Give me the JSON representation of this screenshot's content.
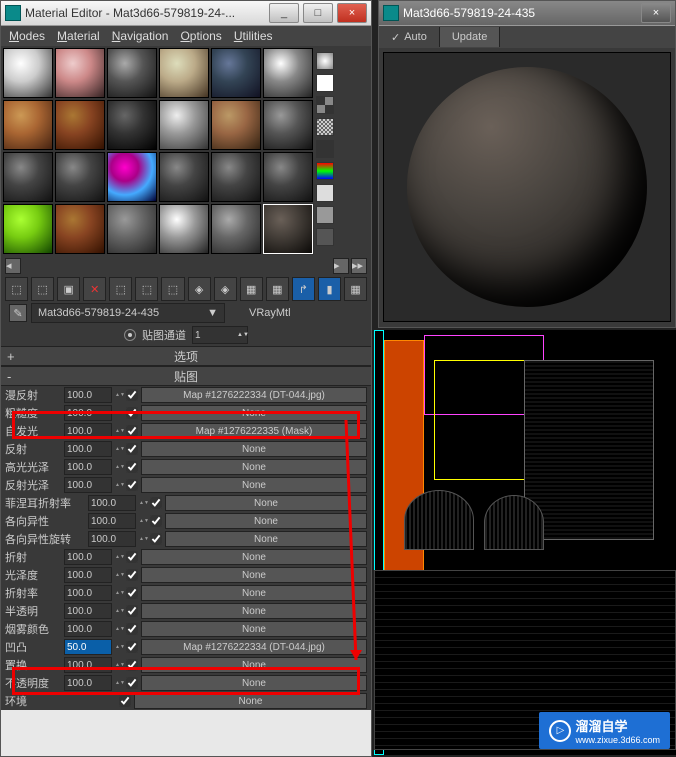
{
  "window": {
    "title": "Material Editor - Mat3d66-579819-24-...",
    "btn_min": "_",
    "btn_max": "□",
    "btn_close": "×"
  },
  "menu": {
    "modes": "Modes",
    "material": "Material",
    "navigation": "Navigation",
    "options": "Options",
    "utilities": "Utilities"
  },
  "material_name": "Mat3d66-579819-24-435",
  "material_type": "VRayMtl",
  "dropdown_arrow": "▼",
  "channel_label": "贴图通道",
  "channel_value": "1",
  "section_options": "选项",
  "section_maps": "贴图",
  "plus": "+",
  "minus": "-",
  "props": [
    {
      "label": "漫反射",
      "val": "100.0",
      "chk": true,
      "map": "Map #1276222334 (DT-044.jpg)",
      "hl": true
    },
    {
      "label": "粗糙度",
      "val": "100.0",
      "chk": true,
      "map": "None"
    },
    {
      "label": "自发光",
      "val": "100.0",
      "chk": true,
      "map": "Map #1276222335 (Mask)"
    },
    {
      "label": "反射",
      "val": "100.0",
      "chk": true,
      "map": "None"
    },
    {
      "label": "高光光泽",
      "val": "100.0",
      "chk": true,
      "map": "None"
    },
    {
      "label": "反射光泽",
      "val": "100.0",
      "chk": true,
      "map": "None"
    },
    {
      "label": "菲涅耳折射率",
      "val": "100.0",
      "chk": true,
      "map": "None",
      "wide": true
    },
    {
      "label": "各向异性",
      "val": "100.0",
      "chk": true,
      "map": "None",
      "wide": true
    },
    {
      "label": "各向异性旋转",
      "val": "100.0",
      "chk": true,
      "map": "None",
      "wide": true
    },
    {
      "label": "折射",
      "val": "100.0",
      "chk": true,
      "map": "None"
    },
    {
      "label": "光泽度",
      "val": "100.0",
      "chk": true,
      "map": "None"
    },
    {
      "label": "折射率",
      "val": "100.0",
      "chk": true,
      "map": "None"
    },
    {
      "label": "半透明",
      "val": "100.0",
      "chk": true,
      "map": "None"
    },
    {
      "label": "烟雾颜色",
      "val": "100.0",
      "chk": true,
      "map": "None"
    },
    {
      "label": "凹凸",
      "val": "50.0",
      "chk": true,
      "map": "Map #1276222334 (DT-044.jpg)",
      "hl": true,
      "selected": true
    },
    {
      "label": "置换",
      "val": "100.0",
      "chk": true,
      "map": "None"
    },
    {
      "label": "不透明度",
      "val": "100.0",
      "chk": true,
      "map": "None"
    },
    {
      "label": "环境",
      "val": "",
      "chk": true,
      "map": "None",
      "noval": true
    }
  ],
  "preview": {
    "title": "Mat3d66-579819-24-435",
    "close": "×",
    "auto": "Auto",
    "update": "Update",
    "auto_checked": "✓"
  },
  "watermark": {
    "text": "溜溜自学",
    "url": "www.zixue.3d66.com",
    "play": "▷"
  }
}
